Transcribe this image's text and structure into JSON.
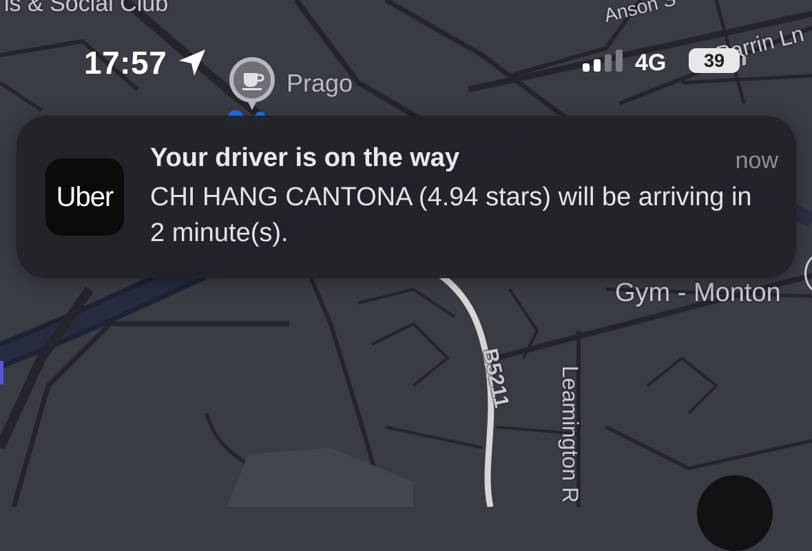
{
  "status_bar": {
    "time": "17:57",
    "network": "4G",
    "battery_level": "39",
    "location_icon": "location-arrow-icon",
    "signal_icon": "cellular-signal-icon"
  },
  "notification": {
    "app_name": "Uber",
    "title": "Your driver is on the way",
    "time": "now",
    "body": "CHI HANG CANTONA (4.94 stars) will be arriving in 2 minute(s)."
  },
  "map": {
    "labels": {
      "club": "is & Social Club",
      "anson": "Anson S",
      "parrin": "Parrin Ln",
      "prago": "Prago",
      "gym": "Gym - Monton",
      "road": "B5211",
      "leamington": "Leamington R"
    },
    "poi_icon": "coffee-cup-icon"
  },
  "colors": {
    "map_background": "#3a3c44",
    "road_minor": "#23252b",
    "road_highlight": "#d6d6d6",
    "notification_bg": "#222329"
  }
}
